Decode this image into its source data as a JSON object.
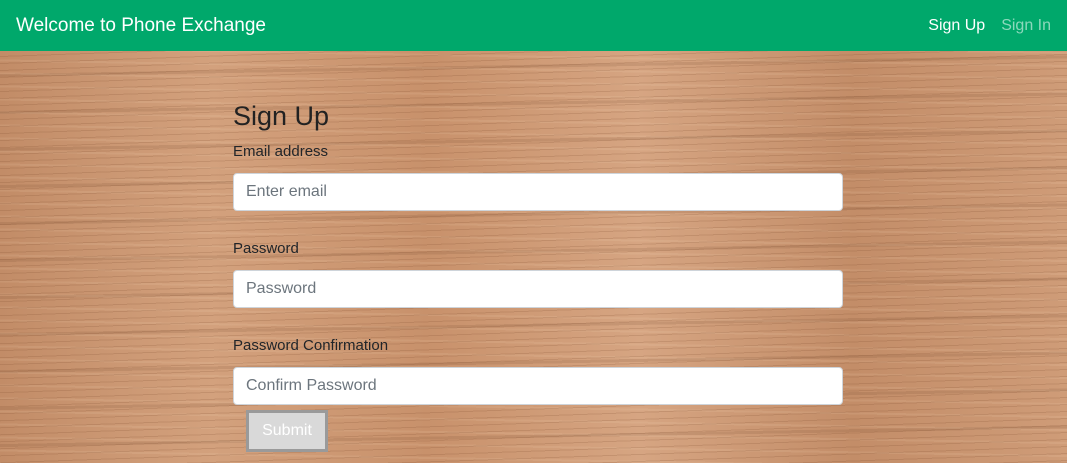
{
  "navbar": {
    "brand": "Welcome to Phone Exchange",
    "links": [
      {
        "label": "Sign Up"
      },
      {
        "label": "Sign In"
      }
    ],
    "bg_color": "#00a86b"
  },
  "form": {
    "title": "Sign Up",
    "email": {
      "label": "Email address",
      "placeholder": "Enter email",
      "value": ""
    },
    "password": {
      "label": "Password",
      "placeholder": "Password",
      "value": ""
    },
    "confirm": {
      "label": "Password Confirmation",
      "placeholder": "Confirm Password",
      "value": ""
    },
    "submit_label": "Submit"
  }
}
